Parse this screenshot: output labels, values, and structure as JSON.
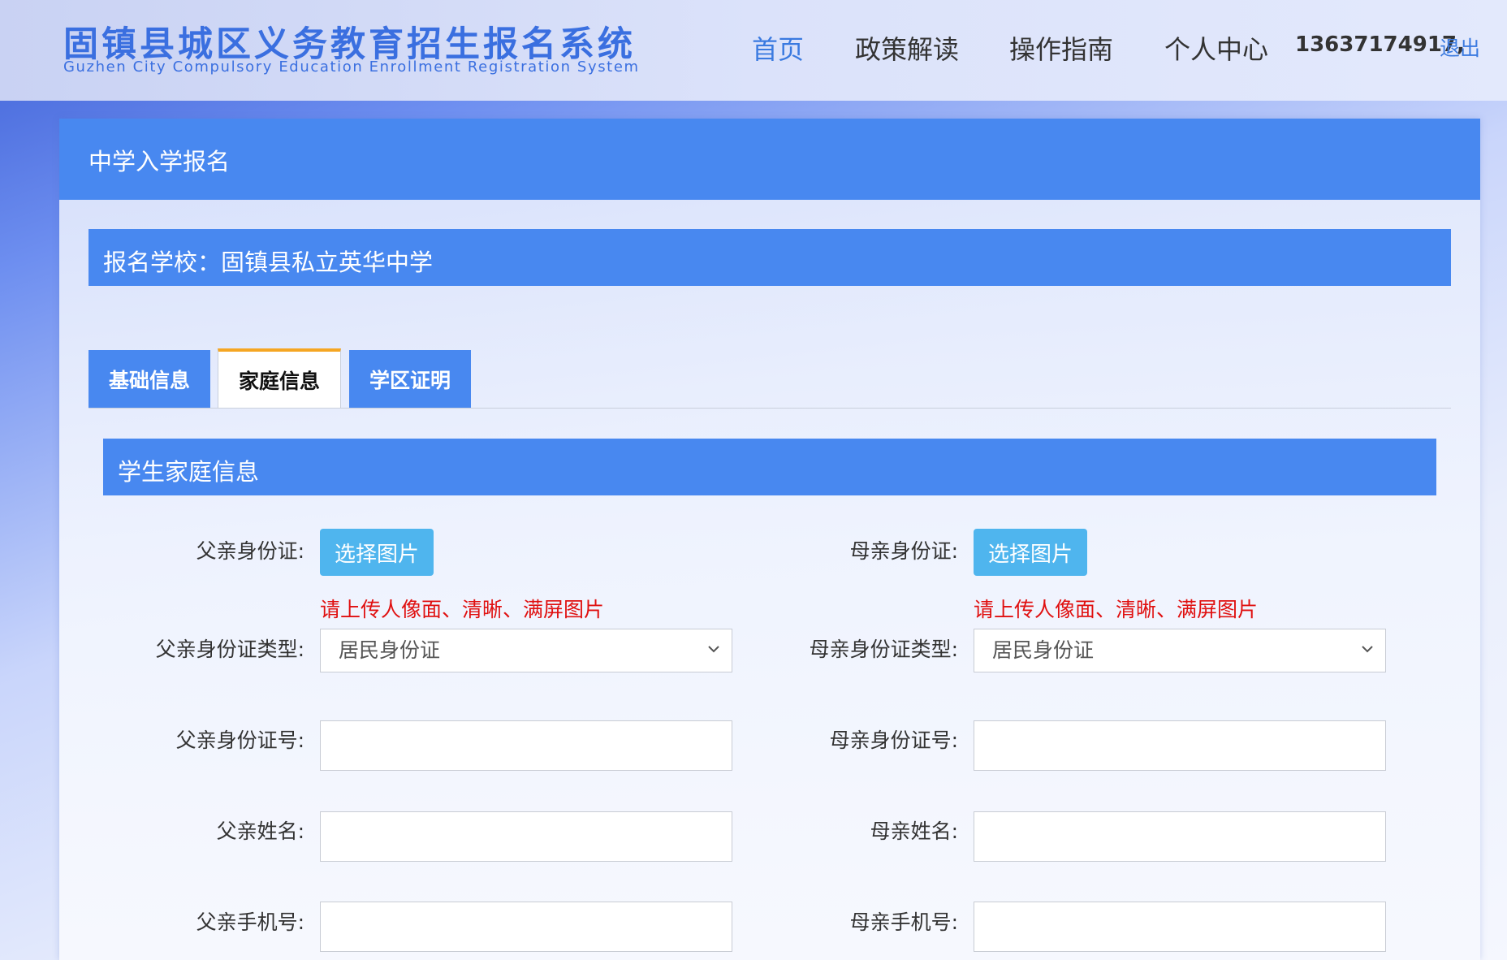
{
  "header": {
    "logo_cn": "固镇县城区义务教育招生报名系统",
    "logo_en": "Guzhen City Compulsory Education Enrollment Registration System",
    "nav": [
      {
        "label": "首页",
        "active": true
      },
      {
        "label": "政策解读",
        "active": false
      },
      {
        "label": "操作指南",
        "active": false
      },
      {
        "label": "个人中心",
        "active": false
      }
    ],
    "user_phone": "13637174917,",
    "logout": "退出"
  },
  "panel": {
    "title": "中学入学报名",
    "school": "报名学校：固镇县私立英华中学",
    "tabs": [
      {
        "label": "基础信息",
        "active": false
      },
      {
        "label": "家庭信息",
        "active": true
      },
      {
        "label": "学区证明",
        "active": false
      }
    ],
    "section_title": "学生家庭信息"
  },
  "form": {
    "father": {
      "id_card_label": "父亲身份证:",
      "upload_button": "选择图片",
      "hint": "请上传人像面、清晰、满屏图片",
      "id_type_label": "父亲身份证类型:",
      "id_type_value": "居民身份证",
      "id_number_label": "父亲身份证号:",
      "id_number_value": "",
      "name_label": "父亲姓名:",
      "name_value": "",
      "phone_label": "父亲手机号:",
      "phone_value": ""
    },
    "mother": {
      "id_card_label": "母亲身份证:",
      "upload_button": "选择图片",
      "hint": "请上传人像面、清晰、满屏图片",
      "id_type_label": "母亲身份证类型:",
      "id_type_value": "居民身份证",
      "id_number_label": "母亲身份证号:",
      "id_number_value": "",
      "name_label": "母亲姓名:",
      "name_value": "",
      "phone_label": "母亲手机号:",
      "phone_value": ""
    }
  },
  "colors": {
    "primary": "#4888f0",
    "upload": "#4fb5ee",
    "hint": "#e01010",
    "tab_accent": "#f5a623",
    "link": "#3a7ae0"
  },
  "icons": {
    "select_arrow": "chevron-down-icon"
  }
}
